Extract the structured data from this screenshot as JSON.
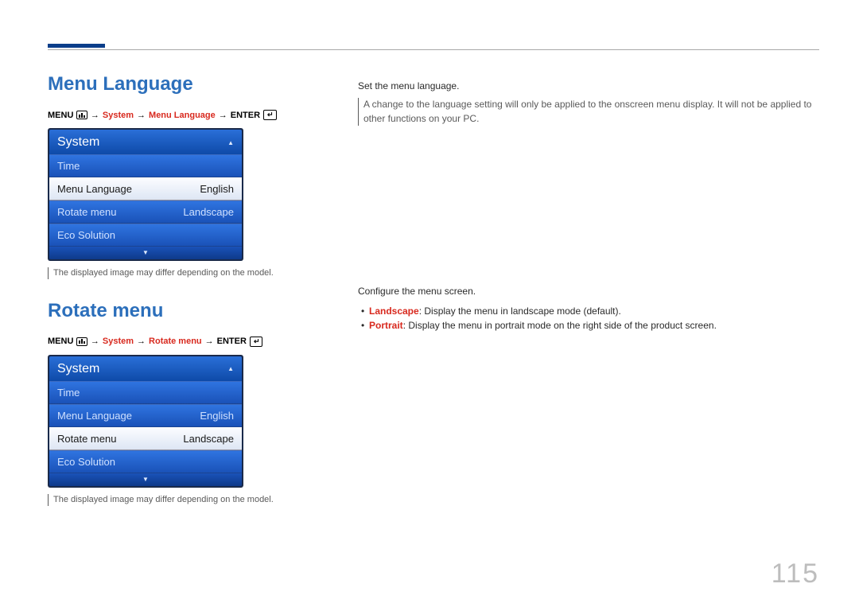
{
  "page_number": "115",
  "section1": {
    "title": "Menu Language",
    "nav": {
      "menu": "MENU",
      "system": "System",
      "item": "Menu Language",
      "enter": "ENTER"
    },
    "osd": {
      "header": "System",
      "rows": [
        {
          "label": "Time",
          "value": "",
          "selected": false
        },
        {
          "label": "Menu Language",
          "value": "English",
          "selected": true
        },
        {
          "label": "Rotate menu",
          "value": "Landscape",
          "selected": false
        },
        {
          "label": "Eco Solution",
          "value": "",
          "selected": false
        }
      ]
    },
    "footnote": "The displayed image may differ depending on the model.",
    "desc": "Set the menu language.",
    "note": "A change to the language setting will only be applied to the onscreen menu display. It will not be applied to other functions on your PC."
  },
  "section2": {
    "title": "Rotate menu",
    "nav": {
      "menu": "MENU",
      "system": "System",
      "item": "Rotate menu",
      "enter": "ENTER"
    },
    "osd": {
      "header": "System",
      "rows": [
        {
          "label": "Time",
          "value": "",
          "selected": false
        },
        {
          "label": "Menu Language",
          "value": "English",
          "selected": false
        },
        {
          "label": "Rotate menu",
          "value": "Landscape",
          "selected": true
        },
        {
          "label": "Eco Solution",
          "value": "",
          "selected": false
        }
      ]
    },
    "footnote": "The displayed image may differ depending on the model.",
    "desc": "Configure the menu screen.",
    "bullets": [
      {
        "term": "Landscape",
        "text": ": Display the menu in landscape mode (default)."
      },
      {
        "term": "Portrait",
        "text": ": Display the menu in portrait mode on the right side of the product screen."
      }
    ]
  }
}
